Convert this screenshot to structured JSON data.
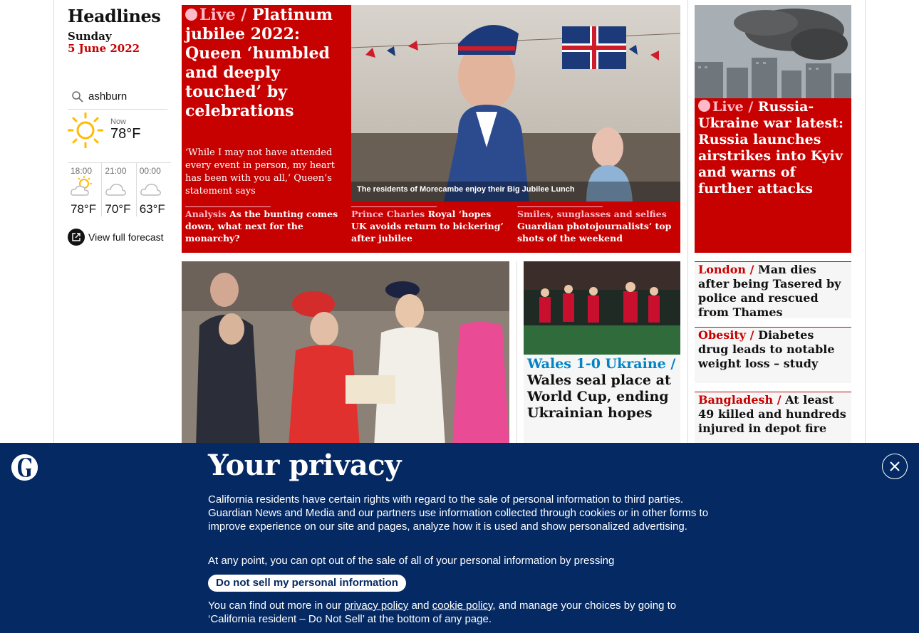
{
  "sidebar": {
    "title": "Headlines",
    "day": "Sunday",
    "date": "5 June 2022",
    "location": "ashburn",
    "now_label": "Now",
    "now_temp": "78°F",
    "forecast": [
      {
        "time": "18:00",
        "temp": "78°F",
        "icon": "partly-sunny-icon"
      },
      {
        "time": "21:00",
        "temp": "70°F",
        "icon": "moon-cloud-icon"
      },
      {
        "time": "00:00",
        "temp": "63°F",
        "icon": "moon-cloud-icon"
      }
    ],
    "full_forecast": "View full forecast"
  },
  "main": {
    "kicker": "Live /",
    "headline": "Platinum jubilee 2022: Queen ‘humbled and deeply touched’ by celebrations",
    "standfirst": "‘While I may not have attended every event in person, my heart has been with you all,’ Queen’s statement says",
    "caption": "The residents of Morecambe enjoy their Big Jubilee Lunch",
    "sublinks": [
      {
        "kicker": "Analysis",
        "text": "As the bunting comes down, what next for the monarchy?"
      },
      {
        "kicker": "Prince Charles",
        "text": "Royal ‘hopes UK avoids return to bickering’ after jubilee"
      },
      {
        "kicker": "Smiles, sunglasses and selfies",
        "text": "Guardian photojournalists’ top shots of the weekend"
      }
    ]
  },
  "ukraine": {
    "kicker": "Live /",
    "headline": "Russia-Ukraine war latest: Russia launches airstrikes into Kyiv and warns of further attacks"
  },
  "small_stories": [
    {
      "kicker": "London /",
      "text": "Man dies after being Tasered by police and rescued from Thames"
    },
    {
      "kicker": "Obesity /",
      "text": "Diabetes drug leads to notable weight loss – study"
    },
    {
      "kicker": "Bangladesh /",
      "text": "At least 49 killed and hundreds injured in depot fire"
    }
  ],
  "wales": {
    "kicker": "Wales 1-0 Ukraine /",
    "headline": "Wales seal place at World Cup, ending Ukrainian hopes"
  },
  "privacy": {
    "title": "Your privacy",
    "para1": "California residents have certain rights with regard to the sale of personal information to third parties. Guardian News and Media and our partners use information collected through cookies or in other forms to improve experience on our site and pages, analyze how it is used and show personalized advertising.",
    "para2": "At any point, you can opt out of the sale of all of your personal information by pressing",
    "button": "Do not sell my personal information",
    "para3_a": "You can find out more in our ",
    "privacy_link": "privacy policy",
    "para3_b": " and ",
    "cookie_link": "cookie policy",
    "para3_c": ", and manage your choices by going to ‘California resident – Do Not Sell’ at the bottom of any page."
  }
}
